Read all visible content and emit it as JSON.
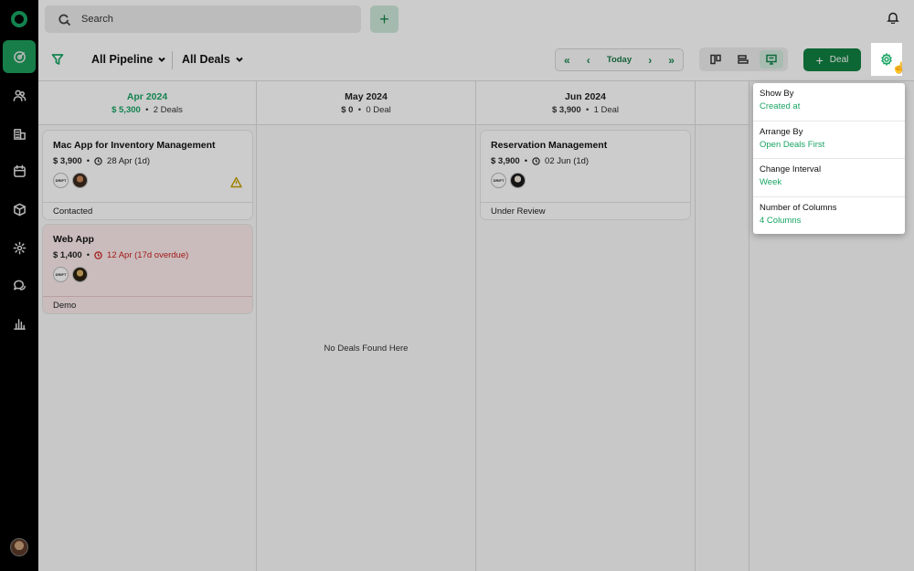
{
  "topbar": {
    "search_placeholder": "Search"
  },
  "sidebar": {
    "items": [
      {
        "icon": "deals-icon",
        "active": true
      },
      {
        "icon": "contacts-icon"
      },
      {
        "icon": "companies-icon"
      },
      {
        "icon": "calendar-icon"
      },
      {
        "icon": "products-icon"
      },
      {
        "icon": "settings-icon"
      },
      {
        "icon": "chat-icon"
      },
      {
        "icon": "reports-icon"
      }
    ]
  },
  "toolbar": {
    "pipeline_label": "All Pipeline",
    "deals_label": "All Deals",
    "today_label": "Today",
    "deal_button_label": "Deal"
  },
  "columns": [
    {
      "month": "Apr 2024",
      "amount": "$ 5,300",
      "count": "2 Deals",
      "cards": [
        {
          "title": "Mac App for Inventory Management",
          "amount": "$ 3,900",
          "due": "28 Apr (1d)",
          "overdue": false,
          "warning": true,
          "stage": "Contacted",
          "company_badge": "DRIFT"
        },
        {
          "title": "Web App",
          "amount": "$ 1,400",
          "due": "12 Apr (17d overdue)",
          "overdue": true,
          "warning": false,
          "stage": "Demo",
          "company_badge": "DRIFT"
        }
      ]
    },
    {
      "month": "May 2024",
      "amount": "$ 0",
      "count": "0 Deal",
      "empty_text": "No Deals Found Here",
      "cards": []
    },
    {
      "month": "Jun 2024",
      "amount": "$ 3,900",
      "count": "1 Deal",
      "cards": [
        {
          "title": "Reservation Management",
          "amount": "$ 3,900",
          "due": "02 Jun (1d)",
          "overdue": false,
          "warning": false,
          "stage": "Under Review",
          "company_badge": "DRIFT"
        }
      ]
    }
  ],
  "settings_popover": {
    "items": [
      {
        "label": "Show By",
        "value": "Created at"
      },
      {
        "label": "Arrange By",
        "value": "Open Deals First"
      },
      {
        "label": "Change Interval",
        "value": "Week"
      },
      {
        "label": "Number of Columns",
        "value": "4 Columns"
      }
    ]
  },
  "colors": {
    "accent": "#19a463",
    "primary_button": "#118142",
    "overdue_text": "#cc2020",
    "sidebar_bg": "#000000"
  }
}
